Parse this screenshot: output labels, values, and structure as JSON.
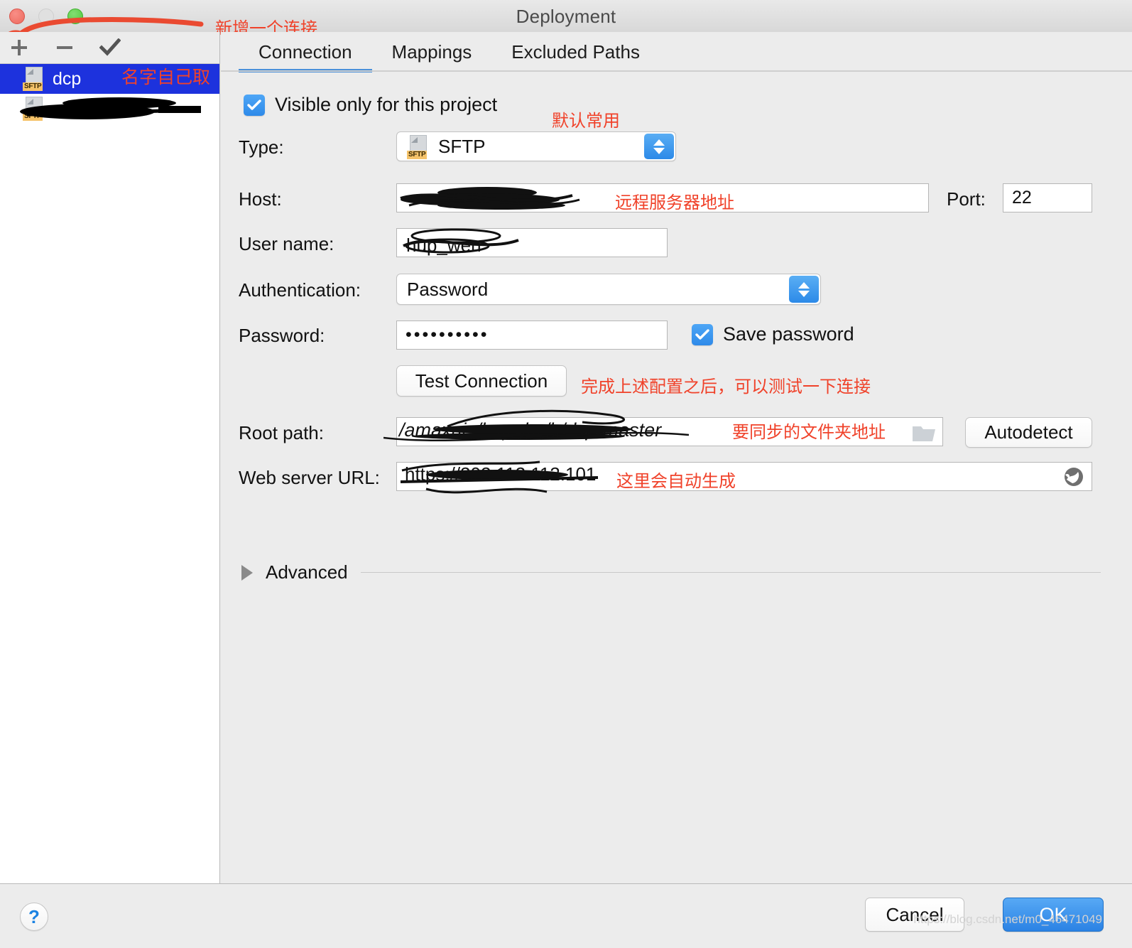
{
  "window": {
    "title": "Deployment",
    "traffic_lights": [
      "close-button",
      "minimize-button",
      "zoom-button"
    ]
  },
  "sidebar": {
    "toolbar": {
      "add_label": "+",
      "remove_label": "−",
      "check_label": "✓"
    },
    "items": [
      {
        "name": "dcp",
        "type_badge": "SFTP",
        "selected": true,
        "redacted": false
      },
      {
        "name": "",
        "type_badge": "SFTP",
        "selected": false,
        "redacted": true
      }
    ]
  },
  "tabs": [
    {
      "label": "Connection",
      "active": true
    },
    {
      "label": "Mappings",
      "active": false
    },
    {
      "label": "Excluded Paths",
      "active": false
    }
  ],
  "form": {
    "visible_only_label": "Visible only for this project",
    "visible_only_checked": true,
    "type_label": "Type:",
    "type_value": "SFTP",
    "type_badge": "SFTP",
    "host_label": "Host:",
    "host_value": "",
    "port_label": "Port:",
    "port_value": "22",
    "username_label": "User name:",
    "username_value": "",
    "auth_label": "Authentication:",
    "auth_value": "Password",
    "password_label": "Password:",
    "password_value": "••••••••••",
    "save_password_label": "Save password",
    "save_password_checked": true,
    "test_connection_label": "Test Connection",
    "root_path_label": "Root path:",
    "root_path_value": "",
    "autodetect_label": "Autodetect",
    "web_server_url_label": "Web server URL:",
    "web_server_url_value": "",
    "advanced_label": "Advanced",
    "advanced_expanded": false
  },
  "footer": {
    "help_label": "?",
    "cancel_label": "Cancel",
    "ok_label": "OK",
    "watermark": "https://blog.csdn.net/m0_46471049"
  },
  "annotations": [
    {
      "id": "add-connection",
      "text": "新增一个连接"
    },
    {
      "id": "name-it-yourself",
      "text": "名字自己取"
    },
    {
      "id": "default-common",
      "text": "默认常用"
    },
    {
      "id": "remote-server-address",
      "text": "远程服务器地址"
    },
    {
      "id": "test-after-config",
      "text": "完成上述配置之后，可以测试一下连接"
    },
    {
      "id": "folder-to-sync",
      "text": "要同步的文件夹地址"
    },
    {
      "id": "auto-generated",
      "text": "这里会自动生成"
    }
  ],
  "colors": {
    "accent_blue": "#2b82e4",
    "tab_underline": "#4a90d9",
    "selection_blue": "#1d32dd",
    "annotation_red": "#f0422a",
    "sftp_badge": "#f5c36a"
  }
}
